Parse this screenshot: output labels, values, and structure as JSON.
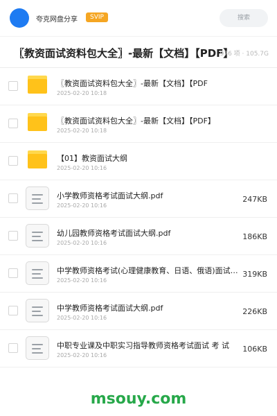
{
  "header": {
    "app_name": "夸克网盘分享",
    "badge": "SVIP",
    "search_placeholder": "搜索"
  },
  "folder_header": {
    "title": "〖教资面试资料包大全〗-最新【文档】【PDF】",
    "meta": "976 项 · 105.7G"
  },
  "files": [
    {
      "type": "folder",
      "name": "〖教资面试资料包大全〗-最新【文档】【PDF",
      "date": "2025-02-20 10:18",
      "size": ""
    },
    {
      "type": "folder",
      "name": "〖教资面试资料包大全〗-最新【文档】【PDF】",
      "date": "2025-02-20 10:18",
      "size": ""
    },
    {
      "type": "folder",
      "name": "【01】教资面试大纲",
      "date": "2025-02-20 10:16",
      "size": ""
    },
    {
      "type": "file",
      "name": "小学教师资格考试面试大纲.pdf",
      "date": "2025-02-20 10:16",
      "size": "247KB"
    },
    {
      "type": "file",
      "name": "幼儿园教师资格考试面试大纲.pdf",
      "date": "2025-02-20 10:16",
      "size": "186KB"
    },
    {
      "type": "file",
      "name": "中学教师资格考试(心理健康教育、日语、俄语)面试大纲.pdf",
      "date": "2025-02-20 10:16",
      "size": "319KB"
    },
    {
      "type": "file",
      "name": "中学教师资格考试面试大纲.pdf",
      "date": "2025-02-20 10:16",
      "size": "226KB"
    },
    {
      "type": "file",
      "name": "中职专业课及中职实习指导教师资格考试面试 考 试",
      "date": "2025-02-20 10:16",
      "size": "106KB"
    }
  ],
  "watermark": "msouy.com",
  "colors": {
    "avatar": "#1e7bf2",
    "svip_badge": "#f5a623",
    "folder": "#ffc21a",
    "watermark": "#27a84a"
  }
}
